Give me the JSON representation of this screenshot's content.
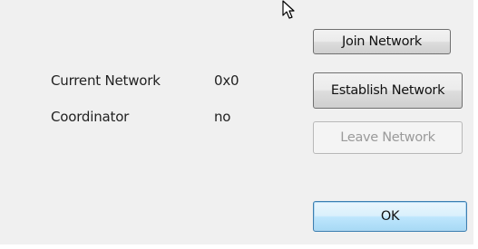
{
  "info": {
    "current_network_label": "Current Network",
    "current_network_value": "0x0",
    "coordinator_label": "Coordinator",
    "coordinator_value": "no"
  },
  "buttons": {
    "join_label": "Join Network",
    "establish_label": "Establish Network",
    "leave_label": "Leave Network",
    "ok_label": "OK"
  },
  "states": {
    "leave_network_enabled": false,
    "ok_is_default": true
  },
  "icons": {
    "cursor": "mouse-pointer-icon"
  },
  "colors": {
    "dialog_bg": "#f0f0f0",
    "button_border": "#707070",
    "disabled_text": "#9a9a9a",
    "default_button_border": "#3c7fb1"
  }
}
